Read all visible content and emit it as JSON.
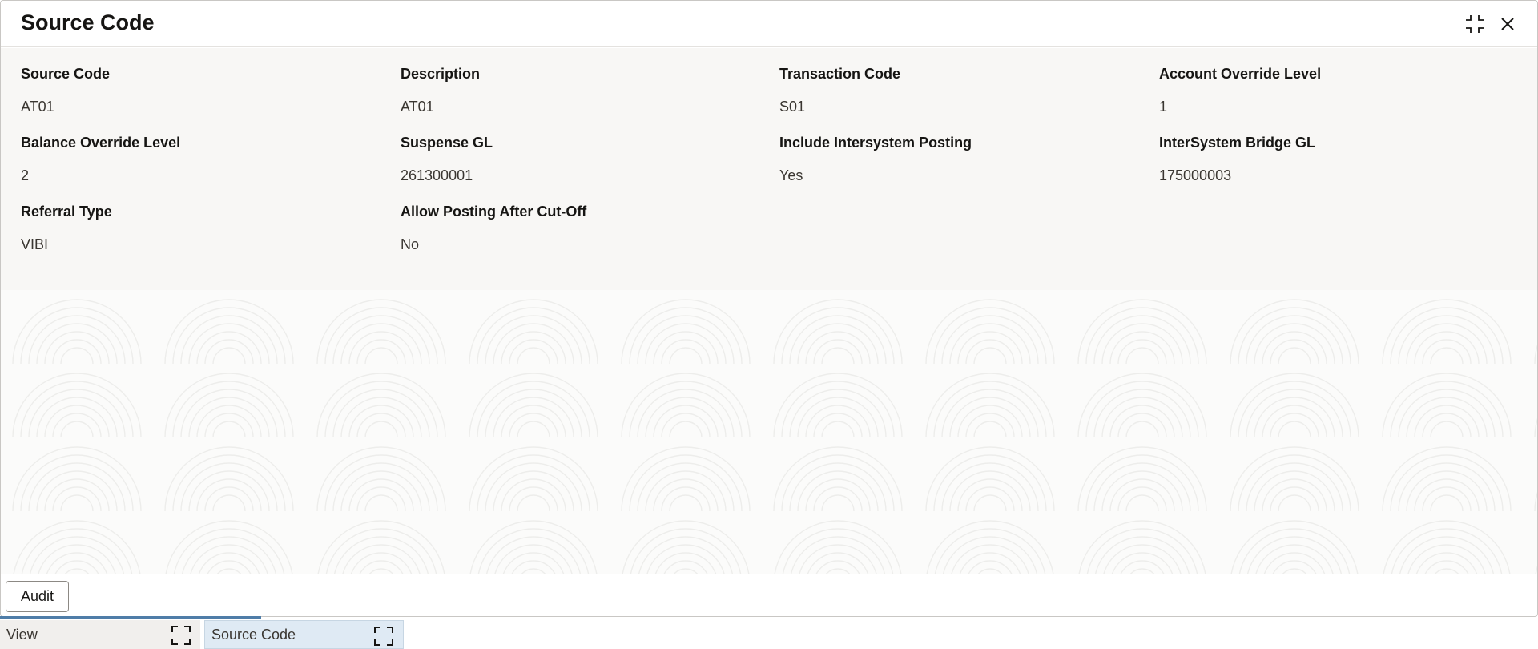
{
  "dialog": {
    "title": "Source Code",
    "minimize_icon": "compress-icon",
    "close_icon": "close-icon"
  },
  "fields": [
    {
      "label": "Source Code",
      "value": "AT01"
    },
    {
      "label": "Description",
      "value": "AT01"
    },
    {
      "label": "Transaction Code",
      "value": "S01"
    },
    {
      "label": "Account Override Level",
      "value": "1"
    },
    {
      "label": "Balance Override Level",
      "value": "2"
    },
    {
      "label": "Suspense GL",
      "value": "261300001"
    },
    {
      "label": "Include Intersystem Posting",
      "value": "Yes"
    },
    {
      "label": "InterSystem Bridge GL",
      "value": "175000003"
    },
    {
      "label": "Referral Type",
      "value": "VIBI"
    },
    {
      "label": "Allow Posting After Cut-Off",
      "value": "No"
    }
  ],
  "footer": {
    "audit_label": "Audit"
  },
  "taskbar": [
    {
      "label": "View",
      "icon": "expand-icon"
    },
    {
      "label": "Source Code",
      "icon": "expand-icon"
    }
  ],
  "colors": {
    "accent": "#4f7da8",
    "active_tab": "#dfeaf4",
    "field_panel": "#f8f7f5"
  }
}
